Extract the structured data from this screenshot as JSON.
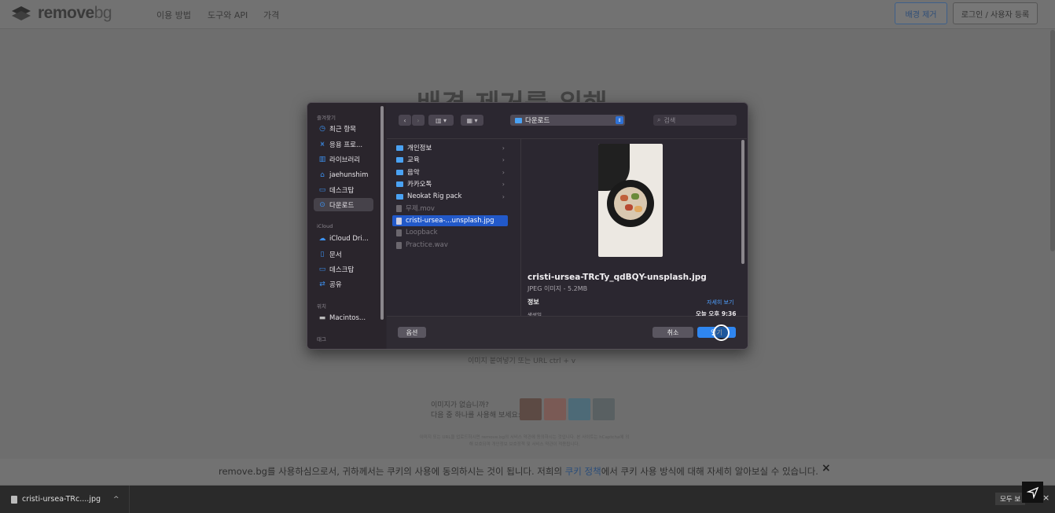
{
  "site": {
    "logo_main": "remove",
    "logo_suffix": "bg",
    "nav": [
      "이용 방법",
      "도구와 API",
      "가격"
    ],
    "btn_remove": "배경 제거",
    "btn_login": "로그인 / 사용자 등록"
  },
  "hero": {
    "heading": "배경 제거를 위해",
    "paste_hint": "이미지 붙여넣기 또는 URL  ctrl + v",
    "no_image_line1": "이미지가 없습니까?",
    "no_image_line2": "다음 중 하나를 사용해 보세요:",
    "fine_print": "이미지 또는 URL을 업로드하시면 remove.bg의 서비스 약관에 동의하시는 것입니다. 본 사이트는 hCaptcha에 의해 보호되며 개인정보 보호정책 및 서비스 약관이 적용됩니다."
  },
  "cookie": {
    "text_before": "remove.bg를 사용하심으로서, 귀하께서는 쿠키의 사용에 동의하시는 것이 됩니다. 저희의 ",
    "link": "쿠키 정책",
    "text_after": "에서 쿠키 사용 방식에 대해 자세히 알아보실 수 있습니다.",
    "close": "×"
  },
  "download_bar": {
    "file": "cristi-ursea-TRc....jpg",
    "show_all": "모두 보",
    "close": "×"
  },
  "dialog": {
    "sidebar": {
      "favorites_title": "즐겨찾기",
      "favorites": [
        {
          "label": "최근 항목",
          "icon": "clock-icon"
        },
        {
          "label": "응용 프로...",
          "icon": "apps-icon"
        },
        {
          "label": "라이브러리",
          "icon": "library-icon"
        },
        {
          "label": "jaehunshim",
          "icon": "home-icon"
        },
        {
          "label": "데스크탑",
          "icon": "desktop-icon"
        },
        {
          "label": "다운로드",
          "icon": "download-icon"
        }
      ],
      "icloud_title": "iCloud",
      "icloud": [
        {
          "label": "iCloud Dri...",
          "icon": "cloud-icon"
        },
        {
          "label": "문서",
          "icon": "document-icon"
        },
        {
          "label": "데스크탑",
          "icon": "desktop-icon"
        },
        {
          "label": "공유",
          "icon": "shared-icon"
        }
      ],
      "locations_title": "위치",
      "locations": [
        {
          "label": "Macintos...",
          "icon": "disk-icon"
        }
      ],
      "tags_title": "태그"
    },
    "current_folder": "다운로드",
    "search_placeholder": "검색",
    "files": [
      {
        "name": "개인정보",
        "type": "folder"
      },
      {
        "name": "교육",
        "type": "folder"
      },
      {
        "name": "음악",
        "type": "folder"
      },
      {
        "name": "카카오톡",
        "type": "folder"
      },
      {
        "name": "Neokat Rig pack",
        "type": "folder"
      },
      {
        "name": "무제.mov",
        "type": "file-dim"
      },
      {
        "name": "cristi-ursea-...unsplash.jpg",
        "type": "file-selected"
      },
      {
        "name": "Loopback",
        "type": "file-dim"
      },
      {
        "name": "Practice.wav",
        "type": "file-dim"
      }
    ],
    "preview": {
      "filename": "cristi-ursea-TRcTy_qdBQY-unsplash.jpg",
      "meta": "JPEG 이미지 - 5.2MB",
      "info": "정보",
      "more": "자세히 보기",
      "created_label": "생성일",
      "created_value": "오늘 오후 9:36"
    },
    "options_btn": "옵션",
    "cancel_btn": "취소",
    "open_btn": "열기"
  }
}
